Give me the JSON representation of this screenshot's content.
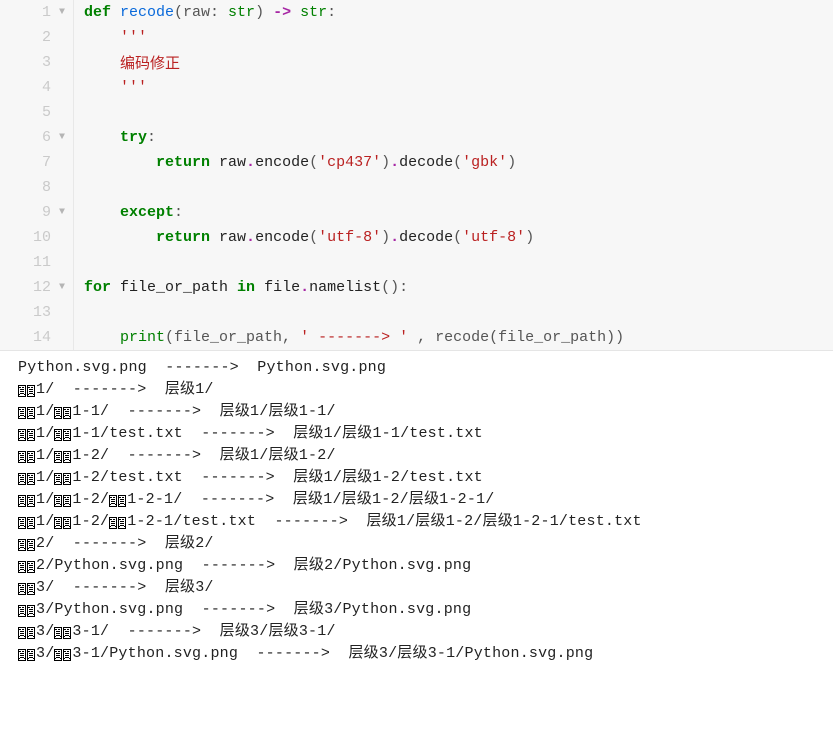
{
  "code": {
    "lines": [
      {
        "n": 1,
        "fold": true,
        "tokens": [
          [
            "kw",
            "def "
          ],
          [
            "func",
            "recode"
          ],
          [
            "punct",
            "(raw: "
          ],
          [
            "builtin",
            "str"
          ],
          [
            "punct",
            ") "
          ],
          [
            "op",
            "->"
          ],
          [
            "punct",
            " "
          ],
          [
            "builtin",
            "str"
          ],
          [
            "punct",
            ":"
          ]
        ]
      },
      {
        "n": 2,
        "fold": false,
        "tokens": [
          [
            "str",
            "    '''"
          ]
        ]
      },
      {
        "n": 3,
        "fold": false,
        "tokens": [
          [
            "str",
            "    编码修正"
          ]
        ]
      },
      {
        "n": 4,
        "fold": false,
        "tokens": [
          [
            "str",
            "    '''"
          ]
        ]
      },
      {
        "n": 5,
        "fold": false,
        "tokens": []
      },
      {
        "n": 6,
        "fold": true,
        "tokens": [
          [
            "kw",
            "    try"
          ],
          [
            "punct",
            ":"
          ]
        ]
      },
      {
        "n": 7,
        "fold": false,
        "tokens": [
          [
            "kw",
            "        return"
          ],
          [
            "name",
            " raw"
          ],
          [
            "op",
            "."
          ],
          [
            "call",
            "encode"
          ],
          [
            "punct",
            "("
          ],
          [
            "str",
            "'cp437'"
          ],
          [
            "punct",
            ")"
          ],
          [
            "op",
            "."
          ],
          [
            "call",
            "decode"
          ],
          [
            "punct",
            "("
          ],
          [
            "str",
            "'gbk'"
          ],
          [
            "punct",
            ")"
          ]
        ]
      },
      {
        "n": 8,
        "fold": false,
        "tokens": []
      },
      {
        "n": 9,
        "fold": true,
        "tokens": [
          [
            "kw",
            "    except"
          ],
          [
            "punct",
            ":"
          ]
        ]
      },
      {
        "n": 10,
        "fold": false,
        "tokens": [
          [
            "kw",
            "        return"
          ],
          [
            "name",
            " raw"
          ],
          [
            "op",
            "."
          ],
          [
            "call",
            "encode"
          ],
          [
            "punct",
            "("
          ],
          [
            "str",
            "'utf-8'"
          ],
          [
            "punct",
            ")"
          ],
          [
            "op",
            "."
          ],
          [
            "call",
            "decode"
          ],
          [
            "punct",
            "("
          ],
          [
            "str",
            "'utf-8'"
          ],
          [
            "punct",
            ")"
          ]
        ]
      },
      {
        "n": 11,
        "fold": false,
        "tokens": []
      },
      {
        "n": 12,
        "fold": true,
        "tokens": [
          [
            "kw",
            "for"
          ],
          [
            "name",
            " file_or_path "
          ],
          [
            "kw",
            "in"
          ],
          [
            "name",
            " file"
          ],
          [
            "op",
            "."
          ],
          [
            "call",
            "namelist"
          ],
          [
            "punct",
            "():"
          ]
        ]
      },
      {
        "n": 13,
        "fold": false,
        "tokens": []
      },
      {
        "n": 14,
        "fold": false,
        "tokens": [
          [
            "name",
            "    "
          ],
          [
            "builtin",
            "print"
          ],
          [
            "punct",
            "(file_or_path, "
          ],
          [
            "str",
            "' -------> '"
          ],
          [
            "punct",
            " , recode(file_or_path))"
          ]
        ]
      }
    ]
  },
  "output": {
    "arrow": "  ------->  ",
    "lines": [
      {
        "raw": "Python.svg.png",
        "decoded": "Python.svg.png",
        "moji": []
      },
      {
        "raw": "##1/",
        "decoded": "层级1/",
        "moji": [
          0,
          1
        ]
      },
      {
        "raw": "##1/##1-1/",
        "decoded": "层级1/层级1-1/",
        "moji": [
          0,
          1,
          4,
          5
        ]
      },
      {
        "raw": "##1/##1-1/test.txt",
        "decoded": "层级1/层级1-1/test.txt",
        "moji": [
          0,
          1,
          4,
          5
        ]
      },
      {
        "raw": "##1/##1-2/",
        "decoded": "层级1/层级1-2/",
        "moji": [
          0,
          1,
          4,
          5
        ]
      },
      {
        "raw": "##1/##1-2/test.txt",
        "decoded": "层级1/层级1-2/test.txt",
        "moji": [
          0,
          1,
          4,
          5
        ]
      },
      {
        "raw": "##1/##1-2/##1-2-1/",
        "decoded": "层级1/层级1-2/层级1-2-1/",
        "moji": [
          0,
          1,
          4,
          5,
          10,
          11
        ]
      },
      {
        "raw": "##1/##1-2/##1-2-1/test.txt",
        "decoded": "层级1/层级1-2/层级1-2-1/test.txt",
        "moji": [
          0,
          1,
          4,
          5,
          10,
          11
        ]
      },
      {
        "raw": "##2/",
        "decoded": "层级2/",
        "moji": [
          0,
          1
        ]
      },
      {
        "raw": "##2/Python.svg.png",
        "decoded": "层级2/Python.svg.png",
        "moji": [
          0,
          1
        ]
      },
      {
        "raw": "##3/",
        "decoded": "层级3/",
        "moji": [
          0,
          1
        ]
      },
      {
        "raw": "##3/Python.svg.png",
        "decoded": "层级3/Python.svg.png",
        "moji": [
          0,
          1
        ]
      },
      {
        "raw": "##3/##3-1/",
        "decoded": "层级3/层级3-1/",
        "moji": [
          0,
          1,
          4,
          5
        ]
      },
      {
        "raw": "##3/##3-1/Python.svg.png",
        "decoded": "层级3/层级3-1/Python.svg.png",
        "moji": [
          0,
          1,
          4,
          5
        ]
      }
    ]
  }
}
